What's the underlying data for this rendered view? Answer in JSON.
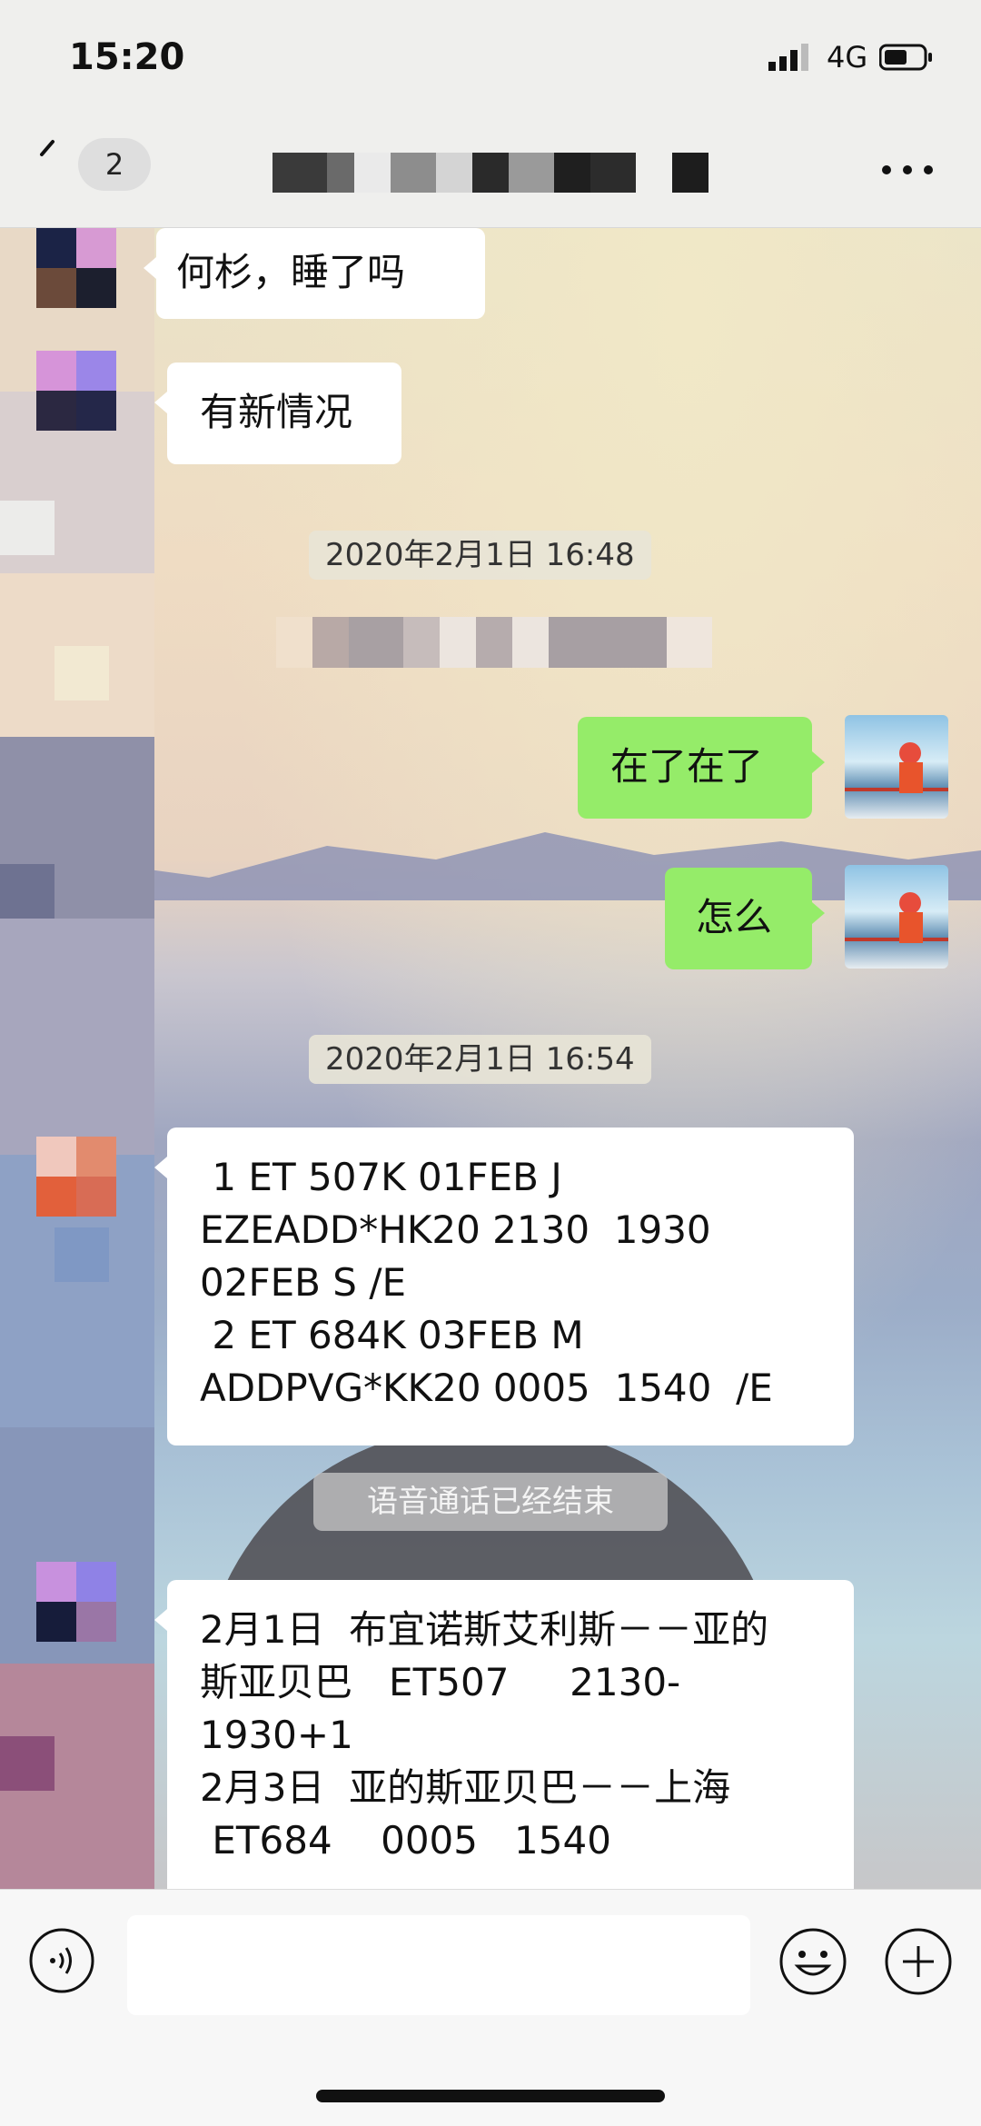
{
  "status_bar": {
    "time": "15:20",
    "network": "4G"
  },
  "nav": {
    "back_icon": "chevron-left-icon",
    "unread_badge": "2",
    "more_icon": "ellipsis-icon"
  },
  "messages": {
    "m1": "何杉，睡了吗",
    "m2": "有新情况",
    "ts1": "2020年2月1日 16:48",
    "m3": "在了在了",
    "m4": "怎么",
    "ts2": "2020年2月1日 16:54",
    "m5": " 1 ET 507K 01FEB J\nEZEADD*HK20 2130  1930\n02FEB S /E\n 2 ET 684K 03FEB M\nADDPVG*KK20 0005  1540  /E",
    "sys": "语音通话已经结束",
    "m6": "2月1日  布宜诺斯艾利斯－－亚的\n斯亚贝巴   ET507     2130-\n1930+1\n2月3日  亚的斯亚贝巴－－上海\n ET684    0005   1540"
  },
  "input_bar": {
    "voice_icon": "voice-icon",
    "emoji_icon": "emoji-icon",
    "plus_icon": "plus-icon",
    "input_value": ""
  },
  "colors": {
    "green_bubble": "#95ec69",
    "white_bubble": "#ffffff",
    "bar_bg": "#f7f7f7"
  }
}
